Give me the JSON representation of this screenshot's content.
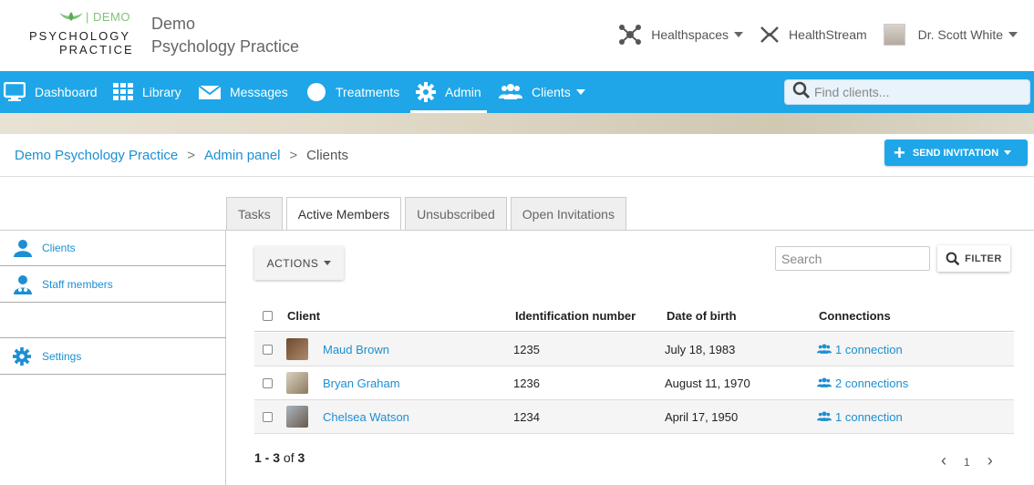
{
  "logo": {
    "demo_tag": "| DEMO",
    "line1": "PSYCHOLOGY",
    "line2": "PRACTICE"
  },
  "practice": {
    "line1": "Demo",
    "line2": "Psychology Practice"
  },
  "top_right": {
    "healthspaces": "Healthspaces",
    "healthstream": "HealthStream",
    "user_name": "Dr. Scott White"
  },
  "nav": {
    "dashboard": "Dashboard",
    "library": "Library",
    "messages": "Messages",
    "treatments": "Treatments",
    "admin": "Admin",
    "clients": "Clients",
    "find_placeholder": "Find clients..."
  },
  "breadcrumb": {
    "practice": "Demo Psychology Practice",
    "sep1": ">",
    "admin": "Admin panel",
    "sep2": ">",
    "current": "Clients"
  },
  "send_invitation": "SEND INVITATION",
  "tabs": [
    "Tasks",
    "Active Members",
    "Unsubscribed",
    "Open Invitations"
  ],
  "active_tab": "Active Members",
  "sidebar": {
    "clients": "Clients",
    "staff": "Staff members",
    "settings": "Settings"
  },
  "toolbar": {
    "actions": "ACTIONS",
    "search_placeholder": "Search",
    "filter": "FILTER"
  },
  "table": {
    "headers": {
      "client": "Client",
      "id": "Identification number",
      "dob": "Date of birth",
      "connections": "Connections"
    },
    "rows": [
      {
        "name": "Maud Brown",
        "id": "1235",
        "dob": "July 18, 1983",
        "connections": "1 connection"
      },
      {
        "name": "Bryan Graham",
        "id": "1236",
        "dob": "August 11, 1970",
        "connections": "2 connections"
      },
      {
        "name": "Chelsea Watson",
        "id": "1234",
        "dob": "April 17, 1950",
        "connections": "1 connection"
      }
    ]
  },
  "pagination": {
    "range": "1 - 3",
    "of_label": "of",
    "total": "3",
    "page": "1",
    "prev": "‹",
    "next": "›"
  },
  "colors": {
    "primary": "#1ea6e8",
    "link": "#1c8fd3",
    "logo_green": "#7fc47a"
  }
}
